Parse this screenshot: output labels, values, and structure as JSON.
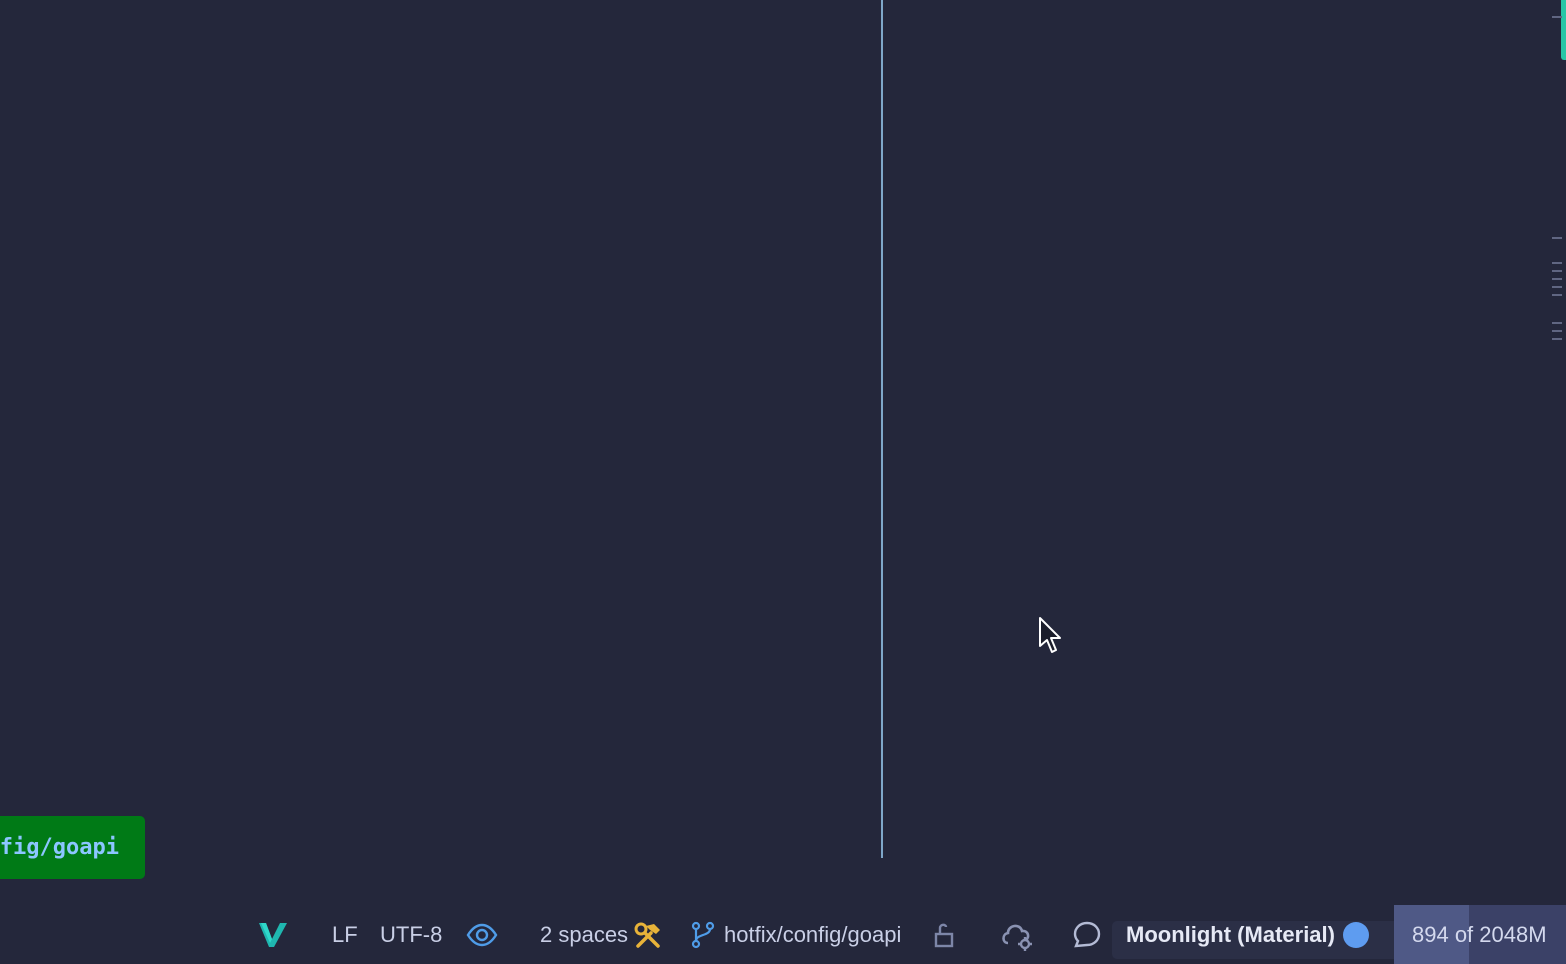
{
  "editor": {
    "branch_popup_text": "fig/goapi"
  },
  "statusbar": {
    "plugin_icon": "vue-icon",
    "line_separator": "LF",
    "encoding": "UTF-8",
    "readonly_icon": "eye-icon",
    "indent": "2 spaces",
    "indent_icon": "hammer-wrench-icon",
    "branch_icon": "git-branch-icon",
    "branch": "hotfix/config/goapi",
    "lock_icon": "unlocked-padlock-icon",
    "inspection_icon": "cloud-gear-icon",
    "ai_icon": "chat-bubble-icon",
    "theme": "Moonlight (Material)",
    "theme_color": "#5e9cf0",
    "memory": {
      "label": "894 of 2048M",
      "used": 894,
      "total": 2048
    }
  },
  "colors": {
    "background": "#24273b",
    "guide": "#7fa7c9",
    "popup": "#007a16",
    "accent": "#26c6a6"
  }
}
